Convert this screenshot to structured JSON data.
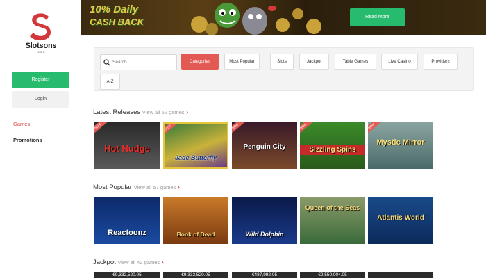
{
  "sidebar": {
    "logo_text": "Slotsons",
    "logo_sub": ".com",
    "register_label": "Register",
    "login_label": "Login",
    "nav": [
      {
        "label": "Games",
        "active": true
      },
      {
        "label": "Promotions",
        "active": false
      }
    ]
  },
  "banner": {
    "title_line1": "10% Daily",
    "title_line2": "CASH BACK",
    "read_more_label": "Read More"
  },
  "filters": {
    "search_placeholder": "Search",
    "chips": [
      "Categories",
      "Most Popular",
      "Slots",
      "Jackpot",
      "Table Games",
      "Live Casino",
      "Providers",
      "A-Z"
    ],
    "active_chip": "Categories"
  },
  "sections": {
    "latest": {
      "title": "Latest Releases",
      "view_all": "View all 62 games",
      "games": [
        "Hot Nudge",
        "Jade Butterfly",
        "Penguin City",
        "Sizzling Spins",
        "Mystic Mirror"
      ],
      "new_badge": "NEW"
    },
    "popular": {
      "title": "Most Popular",
      "view_all": "View all 57 games",
      "games": [
        "Reactoonz",
        "Book of Dead",
        "Wild Dolphin",
        "Queen of the Seas",
        "Atlantis World"
      ]
    },
    "jackpot": {
      "title": "Jackpot",
      "view_all": "View all 42 games",
      "amounts": [
        "€9,332,520.05",
        "€9,332,520.05",
        "€487,992.05",
        "€2,550,004.05",
        ""
      ]
    }
  },
  "colors": {
    "accent_red": "#e35a55",
    "accent_green": "#27bb6e"
  }
}
